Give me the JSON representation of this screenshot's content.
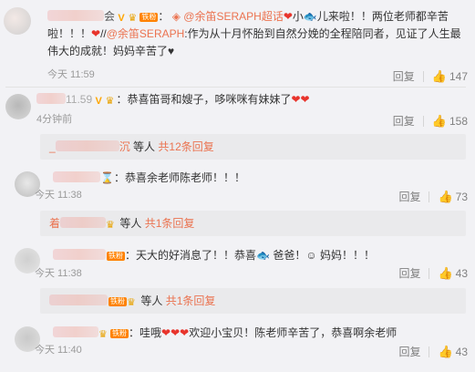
{
  "comments": [
    {
      "body_mention": "@余笛SERAPH超话",
      "body_after_mention": "小",
      "body_text2": "儿来啦！！两位老师都辛苦",
      "body_line2a": "啦！！！",
      "body_line2b": "//",
      "body_mention2": "@余笛SERAPH",
      "body_line2c": ":作为从十月怀胎到自然分娩的全程陪同者，见证了人生最",
      "body_line3": "伟大的成就！妈妈辛苦了",
      "time": "今天 11:59",
      "reply_label": "回复",
      "likes": "147"
    },
    {
      "body": "：恭喜笛哥和嫂子，哆咪咪有妹妹了",
      "time": "4分钟前",
      "reply_label": "回复",
      "likes": "158",
      "sub_tail": "沉",
      "sub_people": "等人",
      "sub_more": "共12条回复",
      "sub_prefix": "_"
    },
    {
      "body": "：恭喜余老师陈老师！！！",
      "time": "今天 11:38",
      "reply_label": "回复",
      "likes": "73",
      "sub_prefix": "着",
      "sub_people": "等人",
      "sub_more": "共1条回复"
    },
    {
      "body": "：天大的好消息了！！恭喜",
      "body2": "爸爸！",
      "body3": "妈妈！！！",
      "time": "今天 11:38",
      "reply_label": "回复",
      "likes": "43",
      "sub_people": "等人",
      "sub_more": "共1条回复"
    },
    {
      "body_pre": "：哇哦",
      "body": "欢迎小宝贝！陈老师辛苦了，恭喜啊余老师",
      "time": "今天 11:40",
      "reply_label": "回复",
      "likes": "43"
    }
  ],
  "badge_label": "铁粉",
  "icons": {
    "like": "thumbs-up-icon",
    "heart": "heart-icon",
    "vip": "vip-v-icon",
    "crown": "crown-icon",
    "fish": "fish-emoji-icon",
    "hourglass": "hourglass-icon"
  },
  "colors": {
    "link": "#eb7350",
    "mention": "#eb7350",
    "heart": "#e8342c",
    "background": "#f2f2f5"
  }
}
